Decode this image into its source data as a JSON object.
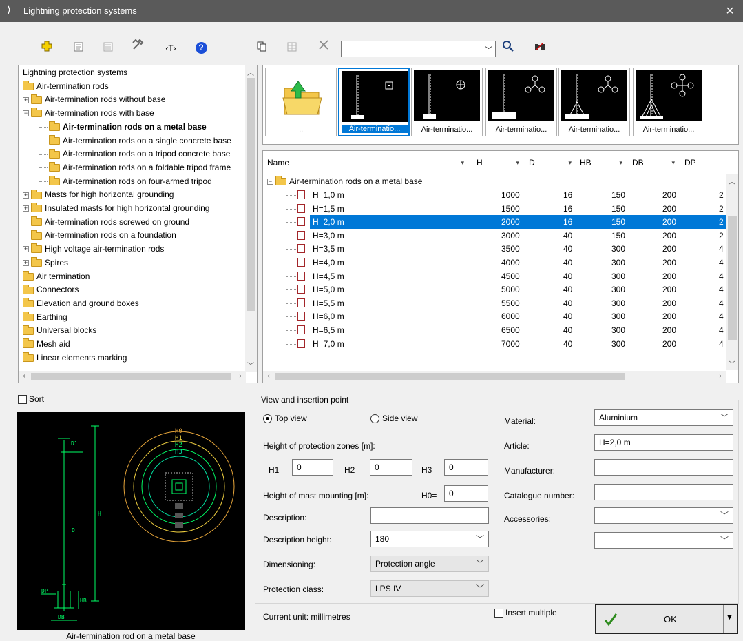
{
  "window": {
    "title": "Lightning protection systems",
    "close_glyph": "×"
  },
  "toolbar": {
    "search_value": "",
    "icons": [
      "add-icon",
      "properties-icon",
      "list-icon",
      "tools-icon",
      "text-tag-icon",
      "help-icon",
      "copy-icon",
      "table-icon",
      "delete-icon",
      "search-icon",
      "find-binoculars-icon"
    ],
    "text_tag_label": "‹T›",
    "help_label": "?"
  },
  "tree": {
    "items": [
      {
        "label": "Lightning protection systems",
        "level": 0,
        "bold": false
      },
      {
        "label": "Air-termination rods",
        "level": 0
      },
      {
        "label": "Air-termination rods without base",
        "level": 1,
        "expander": "+"
      },
      {
        "label": "Air-termination rods with base",
        "level": 1,
        "expander": "−"
      },
      {
        "label": "Air-termination rods on a metal base",
        "level": 2,
        "bold": true
      },
      {
        "label": "Air-termination rods on a single concrete base",
        "level": 2
      },
      {
        "label": "Air-termination rods on a tripod concrete base",
        "level": 2
      },
      {
        "label": "Air-termination rods on a foldable tripod frame",
        "level": 2
      },
      {
        "label": "Air-termination rods on four-armed tripod",
        "level": 2
      },
      {
        "label": "Masts for high horizontal grounding",
        "level": 1,
        "expander": "+"
      },
      {
        "label": "Insulated masts for high horizontal grounding",
        "level": 1,
        "expander": "+"
      },
      {
        "label": "Air-termination rods screwed on ground",
        "level": 1
      },
      {
        "label": "Air-termination rods on a foundation",
        "level": 1
      },
      {
        "label": "High voltage air-termination rods",
        "level": 1,
        "expander": "+"
      },
      {
        "label": "Spires",
        "level": 1,
        "expander": "+"
      },
      {
        "label": "Air termination",
        "level": 0
      },
      {
        "label": "Connectors",
        "level": 0
      },
      {
        "label": "Elevation and ground boxes",
        "level": 0
      },
      {
        "label": "Earthing",
        "level": 0
      },
      {
        "label": "Universal blocks",
        "level": 0
      },
      {
        "label": "Mesh aid",
        "level": 0
      },
      {
        "label": "Linear elements marking",
        "level": 0
      }
    ]
  },
  "thumbnails": [
    {
      "caption": "..",
      "kind": "up-folder"
    },
    {
      "caption": "Air-terminatio...",
      "kind": "rod-square",
      "selected": true
    },
    {
      "caption": "Air-terminatio...",
      "kind": "rod-circle"
    },
    {
      "caption": "Air-terminatio...",
      "kind": "rod-tripod"
    },
    {
      "caption": "Air-terminatio...",
      "kind": "rod-tripod-frame"
    },
    {
      "caption": "Air-terminatio...",
      "kind": "rod-four-arm"
    }
  ],
  "grid": {
    "columns": [
      "Name",
      "H",
      "D",
      "HB",
      "DB",
      "DP"
    ],
    "group_label": "Air-termination rods on a metal base",
    "rows": [
      {
        "name": "H=1,0 m",
        "H": "1000",
        "D": "16",
        "HB": "150",
        "DB": "200",
        "DP": "2"
      },
      {
        "name": "H=1,5 m",
        "H": "1500",
        "D": "16",
        "HB": "150",
        "DB": "200",
        "DP": "2"
      },
      {
        "name": "H=2,0 m",
        "H": "2000",
        "D": "16",
        "HB": "150",
        "DB": "200",
        "DP": "2",
        "selected": true
      },
      {
        "name": "H=3,0 m",
        "H": "3000",
        "D": "40",
        "HB": "150",
        "DB": "200",
        "DP": "2"
      },
      {
        "name": "H=3,5 m",
        "H": "3500",
        "D": "40",
        "HB": "300",
        "DB": "200",
        "DP": "4"
      },
      {
        "name": "H=4,0 m",
        "H": "4000",
        "D": "40",
        "HB": "300",
        "DB": "200",
        "DP": "4"
      },
      {
        "name": "H=4,5 m",
        "H": "4500",
        "D": "40",
        "HB": "300",
        "DB": "200",
        "DP": "4"
      },
      {
        "name": "H=5,0 m",
        "H": "5000",
        "D": "40",
        "HB": "300",
        "DB": "200",
        "DP": "4"
      },
      {
        "name": "H=5,5 m",
        "H": "5500",
        "D": "40",
        "HB": "300",
        "DB": "200",
        "DP": "4"
      },
      {
        "name": "H=6,0 m",
        "H": "6000",
        "D": "40",
        "HB": "300",
        "DB": "200",
        "DP": "4"
      },
      {
        "name": "H=6,5 m",
        "H": "6500",
        "D": "40",
        "HB": "300",
        "DB": "200",
        "DP": "4"
      },
      {
        "name": "H=7,0 m",
        "H": "7000",
        "D": "40",
        "HB": "300",
        "DB": "200",
        "DP": "4"
      }
    ]
  },
  "preview": {
    "sort_label": "Sort",
    "caption": "Air-termination rod on a metal base",
    "labels": {
      "d1": "D1",
      "h": "H",
      "d": "D",
      "dp": "DP",
      "hb": "HB",
      "db": "DB",
      "h0": "H0",
      "h1": "H1",
      "h2": "H2",
      "h3": "H3"
    }
  },
  "form": {
    "group_label": "View and insertion point",
    "top_view": "Top view",
    "side_view": "Side view",
    "heights_label": "Height of protection zones [m]:",
    "h1_label": "H1=",
    "h1_value": "0",
    "h2_label": "H2=",
    "h2_value": "0",
    "h3_label": "H3=",
    "h3_value": "0",
    "mast_label": "Height of mast mounting [m]:",
    "h0_label": "H0=",
    "h0_value": "0",
    "description_label": "Description:",
    "description_value": "",
    "desc_height_label": "Description height:",
    "desc_height_value": "180",
    "dimensioning_label": "Dimensioning:",
    "dimensioning_value": "Protection angle",
    "protection_class_label": "Protection class:",
    "protection_class_value": "LPS IV",
    "material_label": "Material:",
    "material_value": "Aluminium",
    "article_label": "Article:",
    "article_value": "H=2,0 m",
    "manufacturer_label": "Manufacturer:",
    "manufacturer_value": "",
    "catalogue_label": "Catalogue number:",
    "catalogue_value": "",
    "accessories_label": "Accessories:",
    "accessories_value": "",
    "extra_value": "",
    "unit_label": "Current unit: millimetres",
    "insert_multiple": "Insert multiple",
    "ok_label": "OK"
  },
  "colors": {
    "accent": "#0078d7",
    "titlebar": "#5a5a5a",
    "cad_green": "#00ff66",
    "cad_yellow": "#e6a53a",
    "cad_bg": "#000000"
  }
}
